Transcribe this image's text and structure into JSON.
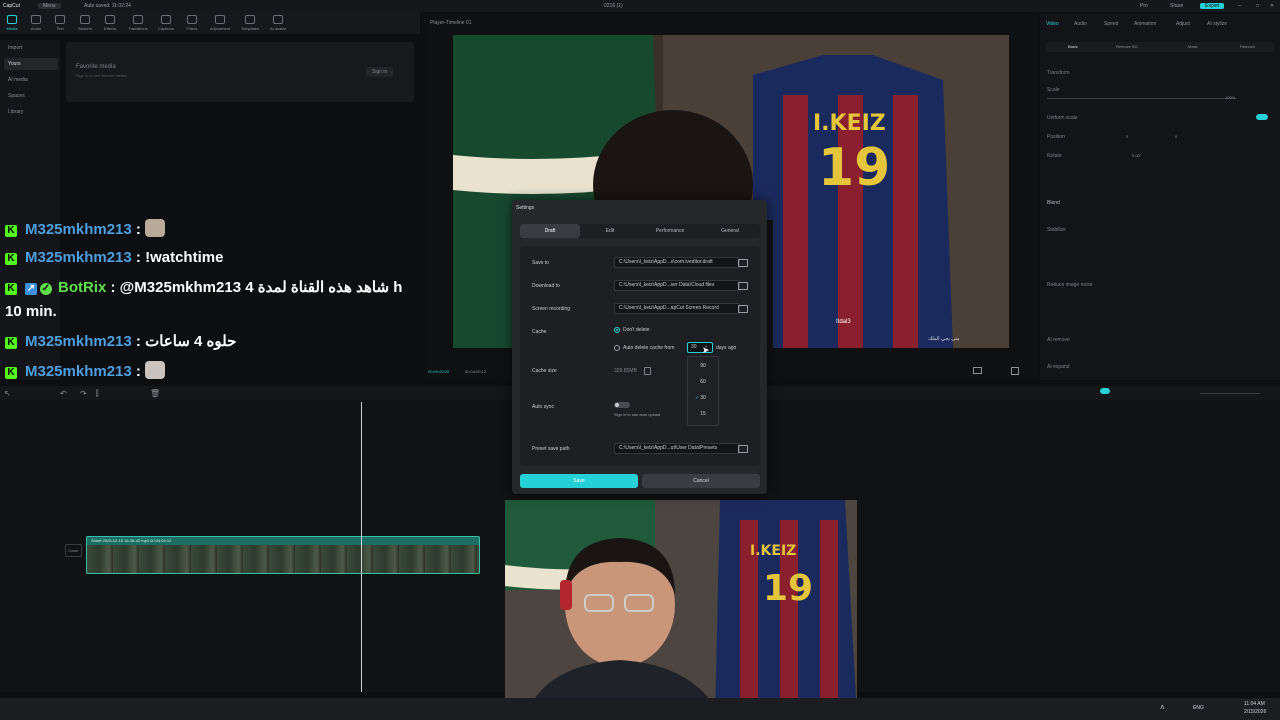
{
  "titlebar": {
    "app": "CapCut",
    "menu": "Menu",
    "autosave": "Auto saved: 11:02:24",
    "project": "0216 (1)",
    "pro": "Pro",
    "share": "Share",
    "export": "Export"
  },
  "toolbar": {
    "items": [
      "Media",
      "Audio",
      "Text",
      "Stickers",
      "Effects",
      "Transitions",
      "Captions",
      "Filters",
      "Adjustment",
      "Templates",
      "AI avatar"
    ]
  },
  "leftnav": {
    "items": [
      "Import",
      "Yours",
      "AI media",
      "Spaces",
      "Library"
    ],
    "selected": 1
  },
  "media": {
    "favorite_title": "Favorite media",
    "favorite_sub": "Sign in to see favorite media",
    "signin": "Sign in"
  },
  "player": {
    "title": "Player-Timeline 01",
    "time_current": "00:00:00:00",
    "time_total": "00:04:09:12"
  },
  "rightpanel": {
    "tabs": [
      "Video",
      "Audio",
      "Speed",
      "Animation",
      "Adjust",
      "AI stylize"
    ],
    "subtabs": [
      "Basic",
      "Remove BG",
      "Mask",
      "Retouch"
    ],
    "transform": "Transform",
    "scale": "Scale",
    "scale_value": "100%",
    "uniform": "Uniform scale",
    "position": "Position",
    "pos_x": "0",
    "pos_y": "0",
    "rotate": "Rotate",
    "rotate_value": "0.00°",
    "blend": "Blend",
    "stabilize": "Stabilize",
    "reduce_noise": "Reduce image noise",
    "ai_remove": "AI remove",
    "ai_expand": "AI expand"
  },
  "chat": [
    {
      "user": "M325mkhm213",
      "msg": ":"
    },
    {
      "user": "M325mkhm213",
      "msg": ": !watchtime"
    },
    {
      "user": "BotRix",
      "msg": ": @M325mkhm213 شاهد هذه القناة لمدة 4 h",
      "msg2": "10 min."
    },
    {
      "user": "M325mkhm213",
      "msg": ": حلوه 4 ساعات"
    },
    {
      "user": "M325mkhm213",
      "msg": ":"
    }
  ],
  "video_overlay": {
    "user": "Itdal3",
    "line2": "متى يجي الملك"
  },
  "timeline": {
    "clip_label": "Sheet 2025-12-16 16-36-42.mp4  00:04:09:12",
    "cover": "Cover"
  },
  "settings": {
    "title": "Settings",
    "tabs": [
      "Draft",
      "Edit",
      "Performance",
      "General"
    ],
    "save_to_label": "Save to",
    "save_to_path": "C:\\Users\\l_keiz\\AppD...s\\com.lveditor.draft",
    "download_label": "Download to",
    "download_path": "C:\\Users\\l_keiz\\AppD...ser Data\\Cloud files",
    "screen_label": "Screen recording",
    "screen_path": "C:\\Users\\l_keiz\\AppD...apCut Screen Record",
    "cache_label": "Cache",
    "dont_delete": "Don't delete",
    "auto_delete": "Auto delete cache from",
    "days_value": "30",
    "days_ago": "days ago",
    "cache_size_label": "Cache size",
    "cache_size": "329.85MB",
    "auto_sync_label": "Auto sync",
    "auto_sync_hint": "Sign in to use auto upload",
    "preset_label": "Preset save path",
    "preset_path": "C:\\Users\\l_keiz\\AppD...ut\\User Data\\Presets",
    "save": "Save",
    "cancel": "Cancel",
    "dropdown_options": [
      "90",
      "60",
      "30",
      "15"
    ],
    "dropdown_selected": "30"
  },
  "taskbar": {
    "lang": "ENG",
    "time": "11:04 AM",
    "date": "2/15/2026"
  },
  "colors": {
    "accent": "#25d0d6",
    "kick_green": "#53fc18",
    "user_blue": "#4e9fe0"
  }
}
